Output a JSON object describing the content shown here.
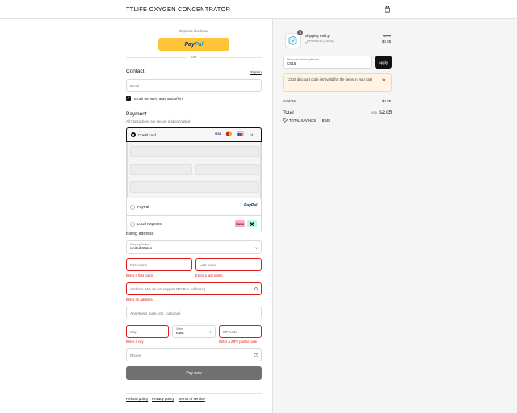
{
  "header": {
    "store_title": "TTLIFE OXYGEN CONCENTRATOR"
  },
  "express": {
    "label": "Express checkout",
    "paypal_a": "Pay",
    "paypal_b": "Pal",
    "or": "OR"
  },
  "contact": {
    "title": "Contact",
    "sign_in": "Sign in",
    "email_placeholder": "Email",
    "newsletter_label": "Email me with news and offers",
    "newsletter_checked": true
  },
  "payment": {
    "title": "Payment",
    "subtitle": "All transactions are secure and encrypted.",
    "credit_card_label": "Credit card",
    "card_logos": [
      "VISA",
      "MC",
      "JCB"
    ],
    "more_cards": "+4",
    "paypal_label": "PayPal",
    "paypal_logo": "PayPal",
    "local_label": "Local Payment",
    "local_badge": "Klarna"
  },
  "billing": {
    "title": "Billing address",
    "country_label": "Country/Region",
    "country_value": "United States",
    "first_name_placeholder": "First name",
    "last_name_placeholder": "Last name",
    "first_name_error": "Enter a first name",
    "last_name_error": "Enter a last name",
    "address_placeholder": "Address (We do not support P.O.Box address.)",
    "address_error": "Enter an address",
    "apartment_placeholder": "Apartment, suite, etc. (optional)",
    "city_placeholder": "City",
    "state_label": "State",
    "state_value": "Iowa",
    "zip_placeholder": "ZIP code",
    "city_error": "Enter a city",
    "zip_error": "Enter a ZIP / postal code",
    "phone_placeholder": "Phone"
  },
  "pay_now_label": "Pay now",
  "footer": {
    "refund": "Refund policy",
    "privacy": "Privacy policy",
    "terms": "Terms of service"
  },
  "summary": {
    "qty": "1",
    "item_name": "Shipping Policy",
    "item_discount": "PRIME15 (-$0.45)",
    "item_original": "$3.00",
    "item_price": "$2.05",
    "discount_label": "Discount code or gift card",
    "discount_value": "CS15",
    "apply_label": "Apply",
    "warning": "CS15 discount code isn't valid for the items in your cart",
    "subtotal_label": "Subtotal",
    "subtotal_value": "$2.05",
    "total_label": "Total",
    "total_currency": "USD",
    "total_value": "$2.05",
    "savings_label": "TOTAL SAVINGS",
    "savings_value": "$0.45"
  },
  "colors": {
    "error": "#dd1d1d",
    "paypal_yellow": "#ffc439",
    "warning_bg": "#fff4e4"
  }
}
